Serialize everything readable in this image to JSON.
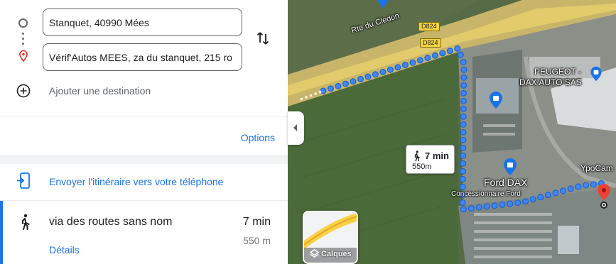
{
  "directions": {
    "origin_value": "Stanquet, 40990 Mées",
    "destination_value": "Vérif'Autos MEES, za du stanquet, 215 ro",
    "add_destination_label": "Ajouter une destination",
    "options_label": "Options",
    "send_to_phone_label": "Envoyer l'itinéraire vers votre téléphone"
  },
  "route": {
    "via_label": "via des routes sans nom",
    "duration": "7 min",
    "distance": "550 m",
    "details_label": "Détails"
  },
  "map": {
    "road_name": "Rte du Cledon",
    "road_shield_1": "D824",
    "road_shield_2": "D824",
    "poi_peugeot": "PEUGEOT -",
    "poi_peugeot_2": "DAX AUTO SAS",
    "poi_ford": "Ford DAX",
    "poi_ford_sub": "Concessionnaire Ford",
    "poi_ypo": "YpoCam",
    "callout_duration": "7 min",
    "callout_distance": "550m",
    "layers_label": "Calques",
    "route_color": "#4285f4",
    "accent_color": "#1a73e8"
  }
}
